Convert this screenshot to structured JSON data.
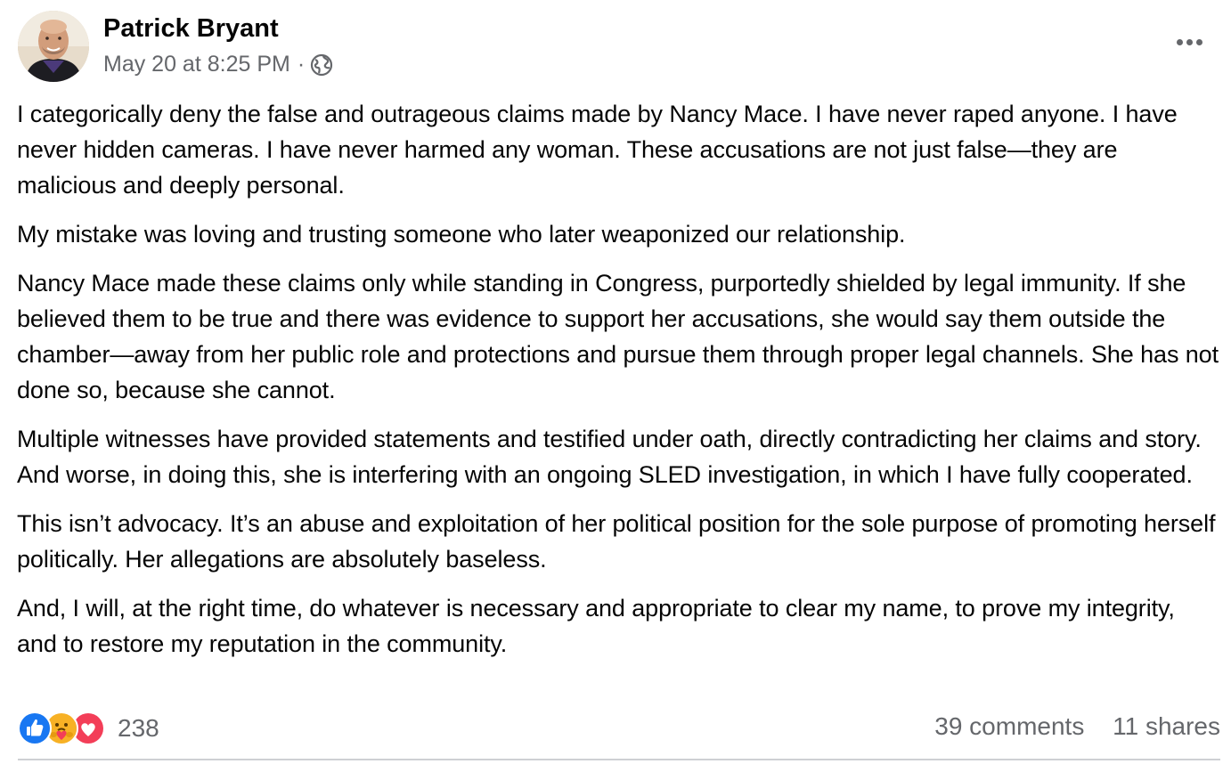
{
  "post": {
    "author": "Patrick Bryant",
    "timestamp": "May 20 at 8:25 PM",
    "separator": "·",
    "audience_icon": "globe-icon",
    "more_icon": "more-horizontal-icon",
    "paragraphs": [
      "I categorically deny the false and outrageous claims made by Nancy Mace. I have never raped anyone. I have never hidden cameras. I have never harmed any woman. These accusations are not just false—they are malicious and deeply personal.",
      "My mistake was loving and trusting someone who later weaponized our relationship.",
      "Nancy Mace made these claims only while standing in Congress, purportedly shielded by legal immunity. If she believed them to be true and there was evidence to support her accusations, she would say them outside the chamber—away from her public role and protections and pursue them through proper legal channels. She has not done so, because she cannot.",
      "Multiple witnesses have provided statements and testified under oath, directly contradicting her claims and story. And worse, in doing this, she is interfering with an ongoing SLED investigation, in which I have fully cooperated.",
      "This isn’t advocacy. It’s an abuse and exploitation of her political position for the sole purpose of promoting herself politically. Her allegations are absolutely baseless.",
      "And, I will, at the right time, do whatever is necessary and appropriate to clear my name, to prove my integrity, and to restore my reputation in the community."
    ]
  },
  "footer": {
    "reactions": [
      "like-icon",
      "care-icon",
      "love-icon"
    ],
    "reaction_count": "238",
    "comments": "39 comments",
    "shares": "11 shares"
  },
  "colors": {
    "text": "#050505",
    "secondary": "#65676b",
    "like": "#1877f2",
    "love": "#f33e58",
    "care": "#f7b125",
    "divider": "#ced0d4"
  }
}
